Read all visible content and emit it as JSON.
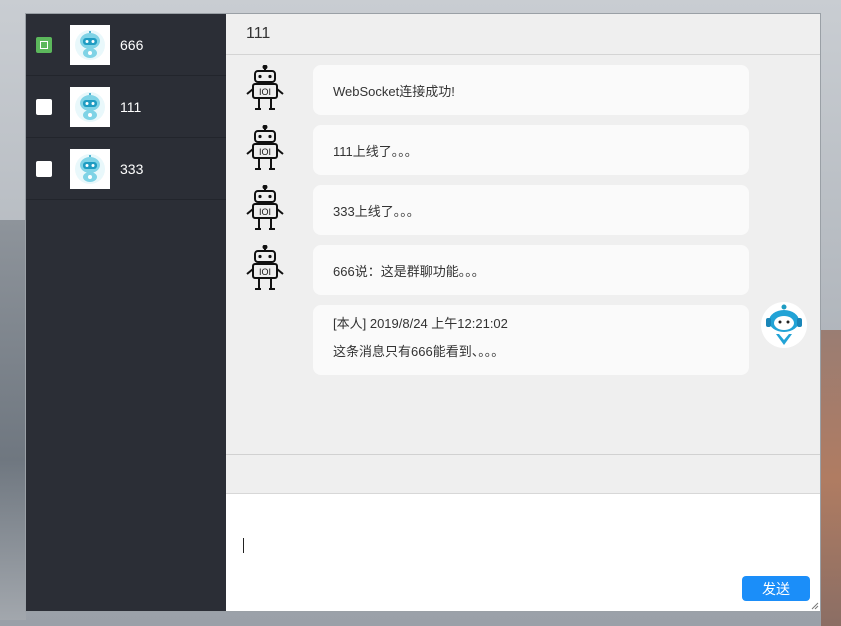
{
  "contacts": [
    {
      "name": "666",
      "checked": true
    },
    {
      "name": "111",
      "checked": false
    },
    {
      "name": "333",
      "checked": false
    }
  ],
  "chat": {
    "title": "111",
    "messages": [
      {
        "text": "WebSocket连接成功!"
      },
      {
        "text": "111上线了。。。"
      },
      {
        "text": "333上线了。。。"
      },
      {
        "text": "666说：这是群聊功能。。。"
      },
      {
        "meta": "[本人] 2019/8/24 上午12:21:02",
        "text": "这条消息只有666能看到、。。。"
      }
    ]
  },
  "input": {
    "send_label": "发送"
  },
  "colors": {
    "sidebar": "#2b2e36",
    "accent": "#1b8ef9",
    "checked": "#5cb85c"
  }
}
